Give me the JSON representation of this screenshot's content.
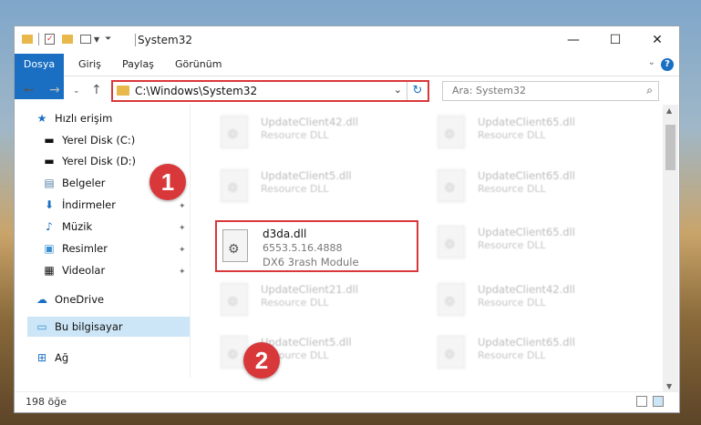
{
  "window": {
    "title": "System32",
    "controls": {
      "minimize": "—",
      "maximize": "☐",
      "close": "✕"
    }
  },
  "ribbon": {
    "tabs": [
      "Dosya",
      "Giriş",
      "Paylaş",
      "Görünüm"
    ],
    "help": "?"
  },
  "address_bar": {
    "path": "C:\\Windows\\System32",
    "search_placeholder": "Ara: System32"
  },
  "nav_pane": {
    "items": [
      {
        "label": "Hızlı erişim",
        "icon": "star-icon"
      },
      {
        "label": "Yerel Disk (C:)",
        "icon": "drive-icon"
      },
      {
        "label": "Yerel Disk (D:)",
        "icon": "drive-icon"
      },
      {
        "label": "Belgeler",
        "icon": "documents-icon"
      },
      {
        "label": "İndirmeler",
        "icon": "download-icon"
      },
      {
        "label": "Müzik",
        "icon": "music-icon"
      },
      {
        "label": "Resimler",
        "icon": "pictures-icon"
      },
      {
        "label": "Videolar",
        "icon": "videos-icon"
      },
      {
        "label": "OneDrive",
        "icon": "cloud-icon"
      },
      {
        "label": "Bu bilgisayar",
        "icon": "computer-icon"
      },
      {
        "label": "Ağ",
        "icon": "network-icon"
      }
    ]
  },
  "files": {
    "left": [
      {
        "name": "UpdateClient42.dll",
        "desc": "Resource DLL"
      },
      {
        "name": "UpdateClient5.dll",
        "desc": "Resource DLL"
      },
      {
        "name": "UpdateClient21.dll",
        "desc": "Resource DLL"
      },
      {
        "name": "UpdateClient5.dll",
        "desc": "Resource DLL"
      }
    ],
    "right": [
      {
        "name": "UpdateClient65.dll",
        "desc": "Resource DLL"
      },
      {
        "name": "UpdateClient65.dll",
        "desc": "Resource DLL"
      },
      {
        "name": "UpdateClient65.dll",
        "desc": "Resource DLL"
      },
      {
        "name": "UpdateClient42.dll",
        "desc": "Resource DLL"
      },
      {
        "name": "UpdateClient65.dll",
        "desc": "Resource DLL"
      }
    ],
    "highlighted": {
      "name": "d3da.dll",
      "version": "6553.5.16.4888",
      "desc": "DX6 3rash Module"
    }
  },
  "status": {
    "count": "198 öğe"
  },
  "annotations": {
    "marker1": "1",
    "marker2": "2",
    "color": "#d9383a"
  }
}
